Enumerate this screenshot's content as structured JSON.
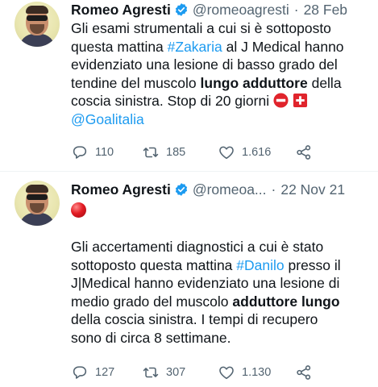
{
  "tweets": [
    {
      "author": "Romeo Agresti",
      "handle": "@romeoagresti",
      "date": "28 Feb",
      "text_lines": [
        "Gli esami strumentali a cui si è sottoposto",
        "questa mattina ",
        "#Zakaria",
        " al J Medical hanno",
        "evidenziato una lesione di basso grado del",
        "tendine del muscolo ",
        "lungo adduttore",
        " della",
        "coscia sinistra. Stop di 20 giorni",
        "@Goalitalia"
      ],
      "replies": "110",
      "retweets": "185",
      "likes": "1.616"
    },
    {
      "author": "Romeo Agresti",
      "handle": "@romeoa...",
      "date": "22 Nov 21",
      "text_lines": [
        "Gli accertamenti diagnostici a cui è stato",
        "sottoposto questa mattina ",
        "#Danilo",
        " presso il",
        "J|Medical hanno evidenziato una lesione di",
        "medio grado del muscolo ",
        "adduttore lungo",
        "della coscia sinistra. I tempi di recupero",
        "sono di circa 8 settimane."
      ],
      "replies": "127",
      "retweets": "307",
      "likes": "1.130"
    }
  ],
  "icons": {
    "verified": "verified-badge-icon",
    "reply": "reply-icon",
    "retweet": "retweet-icon",
    "like": "heart-icon",
    "share": "share-icon",
    "no_entry": "no-entry-emoji",
    "swiss_flag": "swiss-flag-emoji",
    "red_circle": "red-circle-emoji"
  },
  "colors": {
    "link": "#1d9bf0",
    "text": "#0f1419",
    "secondary": "#536471",
    "verified": "#1d9bf0"
  }
}
